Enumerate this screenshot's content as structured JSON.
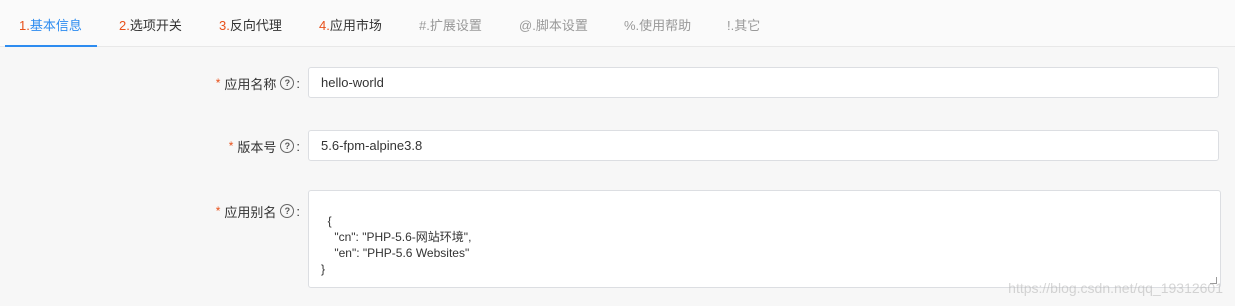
{
  "tabs": [
    {
      "num": "1.",
      "label": "基本信息"
    },
    {
      "num": "2.",
      "label": "选项开关"
    },
    {
      "num": "3.",
      "label": "反向代理"
    },
    {
      "num": "4.",
      "label": "应用市场"
    },
    {
      "num": "#.",
      "label": "扩展设置"
    },
    {
      "num": "@.",
      "label": "脚本设置"
    },
    {
      "num": "%.",
      "label": "使用帮助"
    },
    {
      "num": "!.",
      "label": "其它"
    }
  ],
  "form": {
    "app_name": {
      "label": "应用名称",
      "value": "hello-world"
    },
    "version": {
      "label": "版本号",
      "value": "5.6-fpm-alpine3.8"
    },
    "alias": {
      "label": "应用别名",
      "value": "{\n    \"cn\": \"PHP-5.6-网站环境\",\n    \"en\": \"PHP-5.6 Websites\"\n}"
    },
    "required_mark": "*",
    "help_glyph": "?",
    "colon": ":"
  },
  "watermark": "https://blog.csdn.net/qq_19312601",
  "colors": {
    "accent": "#2d8cf0",
    "required": "#e8501a"
  }
}
